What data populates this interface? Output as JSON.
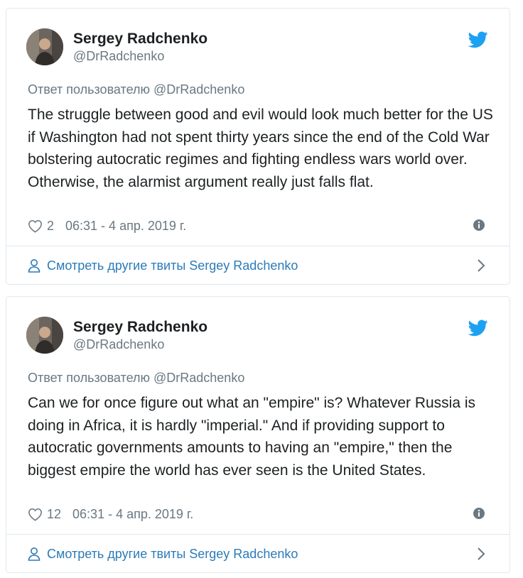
{
  "tweets": [
    {
      "author_name": "Sergey Radchenko",
      "author_handle": "@DrRadchenko",
      "reply_to": "Ответ пользователю @DrRadchenko",
      "text": "The struggle between good and evil would look much better for the US if Washington had not spent thirty years since the end of the Cold War bolstering autocratic regimes and fighting endless wars world over. Otherwise, the alarmist argument really just falls flat.",
      "likes": "2",
      "timestamp": "06:31 - 4 апр. 2019 г.",
      "more_link": "Смотреть другие твиты Sergey Radchenko"
    },
    {
      "author_name": "Sergey Radchenko",
      "author_handle": "@DrRadchenko",
      "reply_to": "Ответ пользователю @DrRadchenko",
      "text": "Can we for once figure out what an \"empire\" is? Whatever Russia is doing in Africa, it is hardly \"imperial.\" And if providing support to autocratic governments amounts to having an \"empire,\" then the biggest empire the world has ever seen is the United States.",
      "likes": "12",
      "timestamp": "06:31 - 4 апр. 2019 г.",
      "more_link": "Смотреть другие твиты Sergey Radchenko"
    }
  ],
  "colors": {
    "twitter_blue": "#1da1f2",
    "link_blue": "#2b7bb9",
    "muted_gray": "#697882",
    "border": "#e1e8ed"
  },
  "icons": [
    "twitter-bird-icon",
    "heart-icon",
    "info-icon",
    "person-icon",
    "chevron-right-icon"
  ]
}
